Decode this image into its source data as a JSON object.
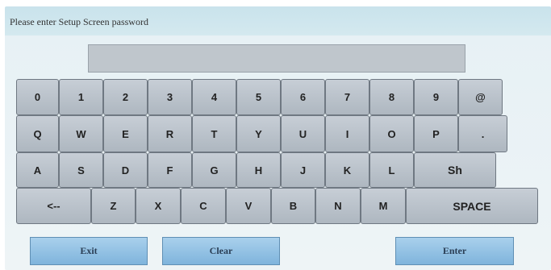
{
  "prompt": "Please enter Setup Screen password",
  "password_value": "",
  "keyboard": {
    "row1": [
      "0",
      "1",
      "2",
      "3",
      "4",
      "5",
      "6",
      "7",
      "8",
      "9",
      "@"
    ],
    "row2": [
      "Q",
      "W",
      "E",
      "R",
      "T",
      "Y",
      "U",
      "I",
      "O",
      "P",
      "."
    ],
    "row3": [
      "A",
      "S",
      "D",
      "F",
      "G",
      "H",
      "J",
      "K",
      "L",
      "Sh"
    ],
    "row4": [
      "<--",
      "Z",
      "X",
      "C",
      "V",
      "B",
      "N",
      "M",
      "SPACE"
    ]
  },
  "buttons": {
    "exit": "Exit",
    "clear": "Clear",
    "enter": "Enter"
  }
}
